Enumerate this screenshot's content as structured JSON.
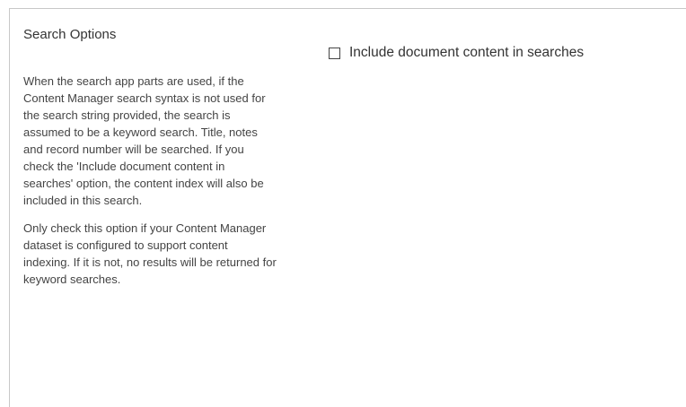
{
  "section": {
    "title": "Search Options",
    "description_1": "When the search app parts are used, if the Content Manager search syntax is not used for the search string provided, the search is assumed to be a keyword search. Title, notes and record number will be searched. If you check the 'Include document content in searches' option, the content index will also be included in this search.",
    "description_2": "Only check this option if your Content Manager dataset is configured to support content indexing. If it is not, no results will be returned for keyword searches."
  },
  "option": {
    "label": "Include document content in searches",
    "checked": false
  }
}
